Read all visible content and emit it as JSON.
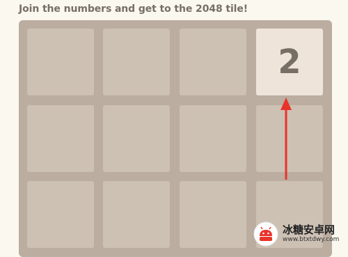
{
  "header": {
    "intro_text": "Join the numbers and get to the 2048 tile!"
  },
  "board": {
    "size": 4,
    "visible_rows": 3,
    "tiles": [
      {
        "row": 0,
        "col": 3,
        "value": "2"
      }
    ]
  },
  "colors": {
    "page_bg": "#faf8ef",
    "board_bg": "#bbada0",
    "empty_cell": "#cdc1b4",
    "tile_2_bg": "#eee4da",
    "tile_text": "#776e65",
    "annotation_arrow": "#e8332a"
  },
  "annotation": {
    "type": "arrow",
    "direction": "up",
    "points_to": "tile-2"
  },
  "watermark": {
    "name": "冰糖安卓网",
    "url": "www.btxtdwy.com"
  }
}
